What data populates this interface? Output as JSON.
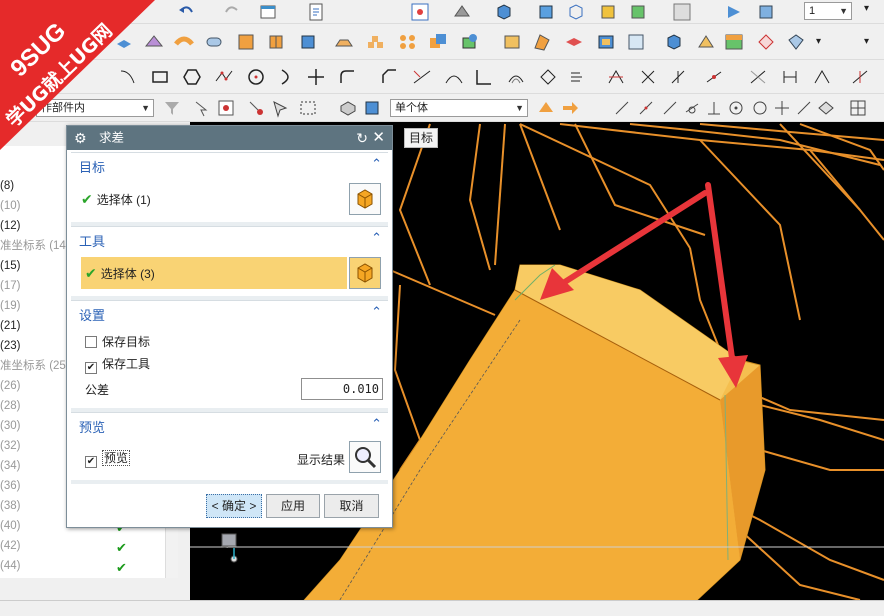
{
  "toolbar": {
    "layer_value": "1",
    "work_part_filter": "作部件内",
    "select_filter": "单个体"
  },
  "navigator": {
    "rows": [
      {
        "label": "(8)",
        "dim": false,
        "check": false
      },
      {
        "label": "(10)",
        "dim": true,
        "check": false
      },
      {
        "label": "(12)",
        "dim": false,
        "check": false
      },
      {
        "label": "准坐标系 (14",
        "dim": true,
        "check": false
      },
      {
        "label": "(15)",
        "dim": false,
        "check": false
      },
      {
        "label": "(17)",
        "dim": true,
        "check": false
      },
      {
        "label": "(19)",
        "dim": true,
        "check": false
      },
      {
        "label": "(21)",
        "dim": false,
        "check": false
      },
      {
        "label": "(23)",
        "dim": false,
        "check": false
      },
      {
        "label": "准坐标系 (25",
        "dim": true,
        "check": false
      },
      {
        "label": "(26)",
        "dim": true,
        "check": false
      },
      {
        "label": "(28)",
        "dim": true,
        "check": false
      },
      {
        "label": "(30)",
        "dim": true,
        "check": false
      },
      {
        "label": "(32)",
        "dim": true,
        "check": false
      },
      {
        "label": "(34)",
        "dim": true,
        "check": false
      },
      {
        "label": "(36)",
        "dim": true,
        "check": false
      },
      {
        "label": "(38)",
        "dim": true,
        "check": false
      },
      {
        "label": "(40)",
        "dim": true,
        "check": true
      },
      {
        "label": "(42)",
        "dim": true,
        "check": true
      },
      {
        "label": "(44)",
        "dim": true,
        "check": true
      }
    ]
  },
  "viewport": {
    "label": "目标"
  },
  "watermark": {
    "site": "9SUG",
    "slogan": "学UG就上UG网"
  },
  "dialog": {
    "title": "求差",
    "target": {
      "header": "目标",
      "select_label": "选择体 (1)"
    },
    "tool": {
      "header": "工具",
      "select_label": "选择体 (3)"
    },
    "settings": {
      "header": "设置",
      "keep_target_label": "保存目标",
      "keep_target_checked": false,
      "keep_tool_label": "保存工具",
      "keep_tool_checked": true,
      "tolerance_label": "公差",
      "tolerance_value": "0.010"
    },
    "preview": {
      "header": "预览",
      "preview_label": "预览",
      "preview_checked": true,
      "show_result_label": "显示结果"
    },
    "buttons": {
      "ok": "< 确定 >",
      "apply": "应用",
      "cancel": "取消"
    }
  },
  "colors": {
    "dialog_title_bg": "#5e7480",
    "section_header": "#2b62b6",
    "active_row": "#f9d374",
    "model_orange": "#f3a43a",
    "model_face": "#f5c15a",
    "arrow_red": "#e8353a",
    "watermark_red": "#e52a2a"
  }
}
